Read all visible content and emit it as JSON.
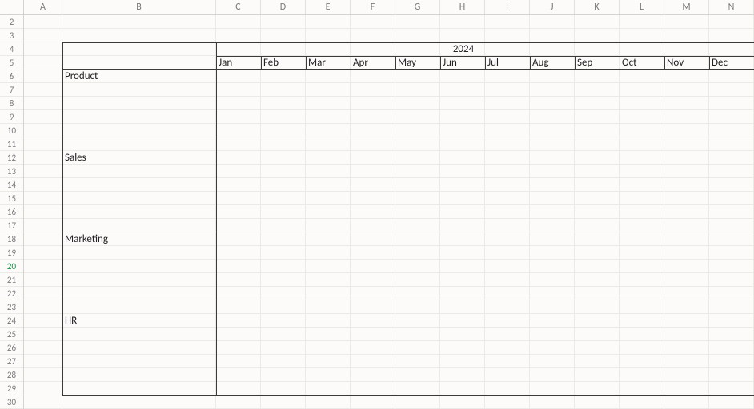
{
  "columns": {
    "labels": [
      "A",
      "B",
      "C",
      "D",
      "E",
      "F",
      "G",
      "H",
      "I",
      "J",
      "K",
      "L",
      "M",
      "N"
    ],
    "widths": [
      48,
      192,
      56,
      56,
      56,
      56,
      56,
      56,
      56,
      56,
      56,
      56,
      56,
      56
    ]
  },
  "rows": {
    "start": 2,
    "end": 30
  },
  "selected_row": 20,
  "cells": {
    "year_header": "2024",
    "months": [
      "Jan",
      "Feb",
      "Mar",
      "Apr",
      "May",
      "Jun",
      "Jul",
      "Aug",
      "Sep",
      "Oct",
      "Nov",
      "Dec"
    ],
    "categories": {
      "r6": "Product",
      "r12": "Sales",
      "r18": "Marketing",
      "r24": "HR"
    }
  },
  "layout": {
    "header_row": 4,
    "months_row": 5,
    "category_col": "B",
    "months_start_col": "C"
  }
}
